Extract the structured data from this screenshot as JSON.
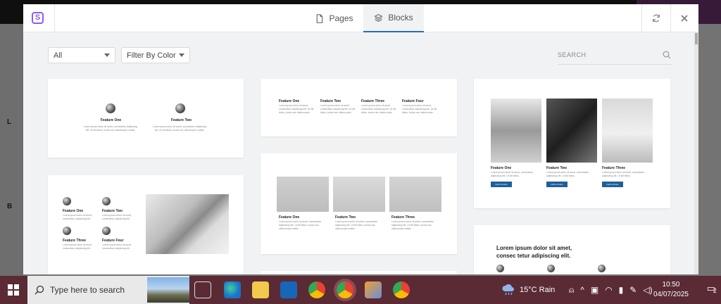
{
  "background": {
    "side_labels": [
      "L",
      "B"
    ]
  },
  "modal": {
    "tabs": [
      {
        "label": "Pages",
        "icon": "page-icon",
        "active": false
      },
      {
        "label": "Blocks",
        "icon": "layers-icon",
        "active": true
      }
    ],
    "filters": {
      "category_value": "All",
      "color_value": "Filter By Color"
    },
    "search": {
      "placeholder": "SEARCH"
    },
    "cards": {
      "two_features": {
        "items": [
          "Feature One",
          "Feature Two"
        ],
        "text": "Lorem ipsum dolor sit amet, consectetur adipiscing elit. Ut elit tellus, luctus nec ullamcorper mattis."
      },
      "four_columns": {
        "items": [
          "Feature One",
          "Feature Two",
          "Feature Three",
          "Feature Four"
        ],
        "text": "Lorem ipsum dolor sit amet, consectetur adipiscing elit. Ut elit tellus, luctus nec ullamcorper."
      },
      "three_images_buttons": {
        "items": [
          "Feature One",
          "Feature Two",
          "Feature Three"
        ],
        "text": "Lorem ipsum dolor sit amet, consectetur adipiscing elit. Ut elit tellus.",
        "button": "Call to Action"
      },
      "grid_with_image": {
        "items": [
          "Feature One",
          "Feature Two",
          "Feature Three",
          "Feature Four"
        ],
        "text": "Lorem ipsum dolor sit amet, consectetur adipiscing elit."
      },
      "three_plants": {
        "items": [
          "Feature One",
          "Feature Two",
          "Feature Three"
        ],
        "text": "Lorem ipsum dolor sit amet, consectetur adipiscing elit. Ut elit tellus, luctus nec ullamcorper mattis."
      },
      "heading_block": {
        "heading": "Lorem ipsum dolor sit amet, consec tetur adipiscing elit."
      }
    }
  },
  "taskbar": {
    "search_placeholder": "Type here to search",
    "weather": "15°C  Rain",
    "time": "10:50",
    "date": "04/07/2025",
    "notification_count": "2"
  }
}
